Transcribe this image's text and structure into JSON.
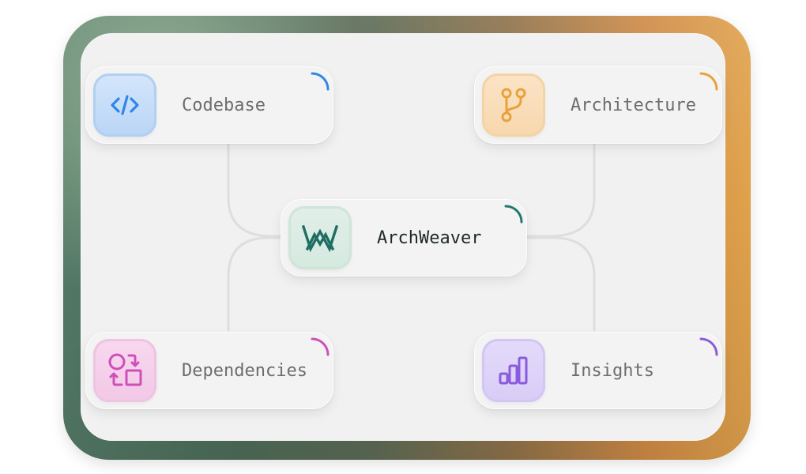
{
  "diagram": {
    "center": {
      "label": "ArchWeaver",
      "icon": "archweaver-logo-icon",
      "accent": "#1f7a6c"
    },
    "nodes": [
      {
        "id": "codebase",
        "label": "Codebase",
        "icon": "code-icon",
        "accent": "#2f86e8"
      },
      {
        "id": "architecture",
        "label": "Architecture",
        "icon": "git-branch-icon",
        "accent": "#e8a23a"
      },
      {
        "id": "dependencies",
        "label": "Dependencies",
        "icon": "dependencies-icon",
        "accent": "#cf4fb8"
      },
      {
        "id": "insights",
        "label": "Insights",
        "icon": "bar-chart-icon",
        "accent": "#8a5bdc"
      }
    ],
    "connector_color": "#dcdcdc",
    "frame_colors": [
      "#547a67",
      "#e0a24c"
    ]
  }
}
